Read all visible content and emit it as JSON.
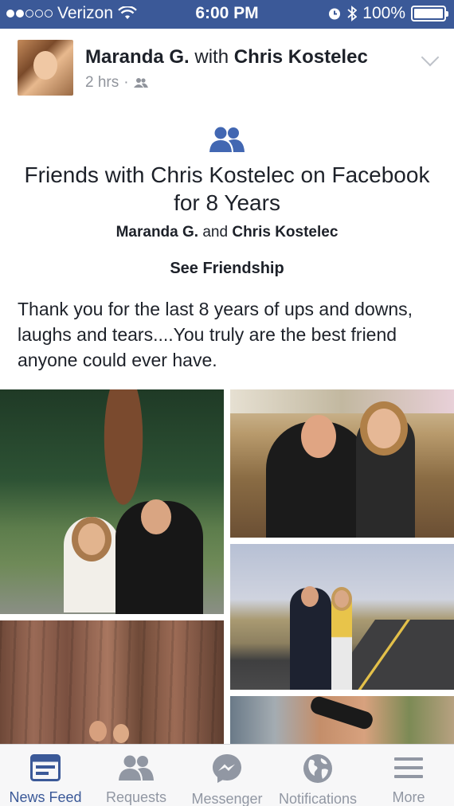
{
  "status_bar": {
    "carrier": "Verizon",
    "time": "6:00 PM",
    "battery": "100%",
    "signal_bars_filled": 2,
    "signal_bars_total": 5
  },
  "post": {
    "author": "Maranda G.",
    "with_word": "with",
    "tagged": "Chris Kostelec",
    "time_ago": "2 hrs",
    "separator": "·",
    "friendship_card": {
      "title": "Friends with Chris Kostelec on Facebook for 8 Years",
      "name_a": "Maranda G.",
      "and_word": "and",
      "name_b": "Chris Kostelec",
      "cta": "See Friendship"
    },
    "text": "Thank you for the last 8 years of ups and downs, laughs and tears....You truly are the best friend anyone could ever have."
  },
  "tab_bar": {
    "tabs": [
      {
        "label": "News Feed",
        "icon": "news-feed-icon",
        "active": true
      },
      {
        "label": "Requests",
        "icon": "friend-requests-icon",
        "active": false
      },
      {
        "label": "Messenger",
        "icon": "messenger-icon",
        "active": false
      },
      {
        "label": "Notifications",
        "icon": "globe-icon",
        "active": false
      },
      {
        "label": "More",
        "icon": "menu-icon",
        "active": false
      }
    ]
  },
  "colors": {
    "brand": "#3b5998",
    "inactive_tab": "#9197a3",
    "meta_text": "#90949c"
  }
}
